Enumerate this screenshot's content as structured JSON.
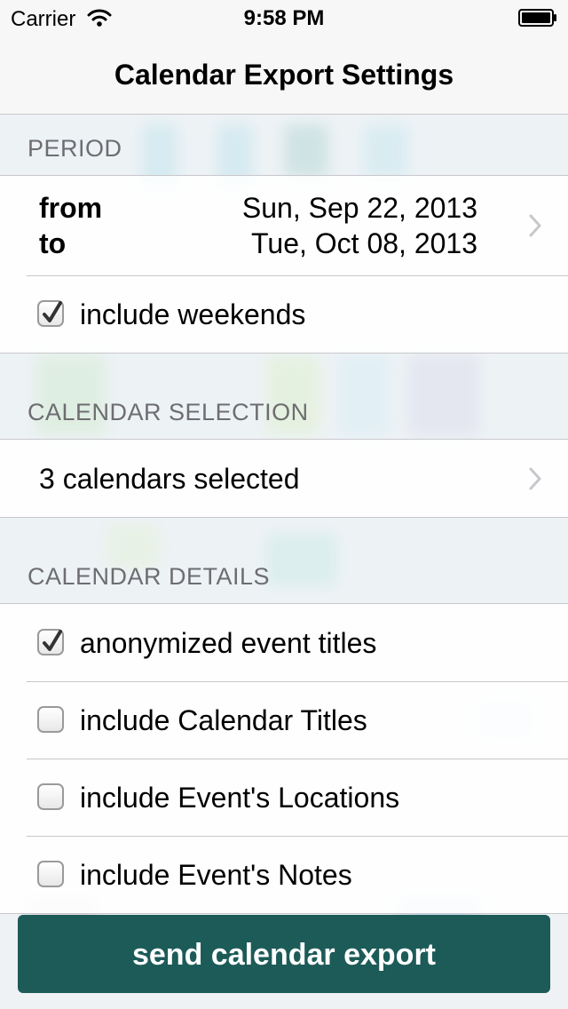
{
  "status_bar": {
    "carrier": "Carrier",
    "time": "9:58 PM"
  },
  "nav": {
    "title": "Calendar Export Settings"
  },
  "period": {
    "header": "PERIOD",
    "from_label": "from",
    "to_label": "to",
    "from_date": "Sun, Sep 22, 2013",
    "to_date": "Tue, Oct 08, 2013",
    "include_weekends_label": "include weekends",
    "include_weekends_checked": true
  },
  "calendar_selection": {
    "header": "CALENDAR SELECTION",
    "summary": "3 calendars selected"
  },
  "calendar_details": {
    "header": "CALENDAR DETAILS",
    "options": [
      {
        "label": "anonymized event titles",
        "checked": true
      },
      {
        "label": "include Calendar Titles",
        "checked": false
      },
      {
        "label": "include Event's Locations",
        "checked": false
      },
      {
        "label": "include Event's Notes",
        "checked": false
      }
    ]
  },
  "send_button": {
    "label": "send calendar export"
  },
  "colors": {
    "accent": "#1c5b58",
    "section_text": "#6d6d72",
    "chevron": "#c7c7cc"
  },
  "icons": {
    "wifi": "wifi-icon",
    "battery": "battery-icon",
    "chevron": "chevron-right-icon",
    "checkmark": "checkmark-icon"
  }
}
